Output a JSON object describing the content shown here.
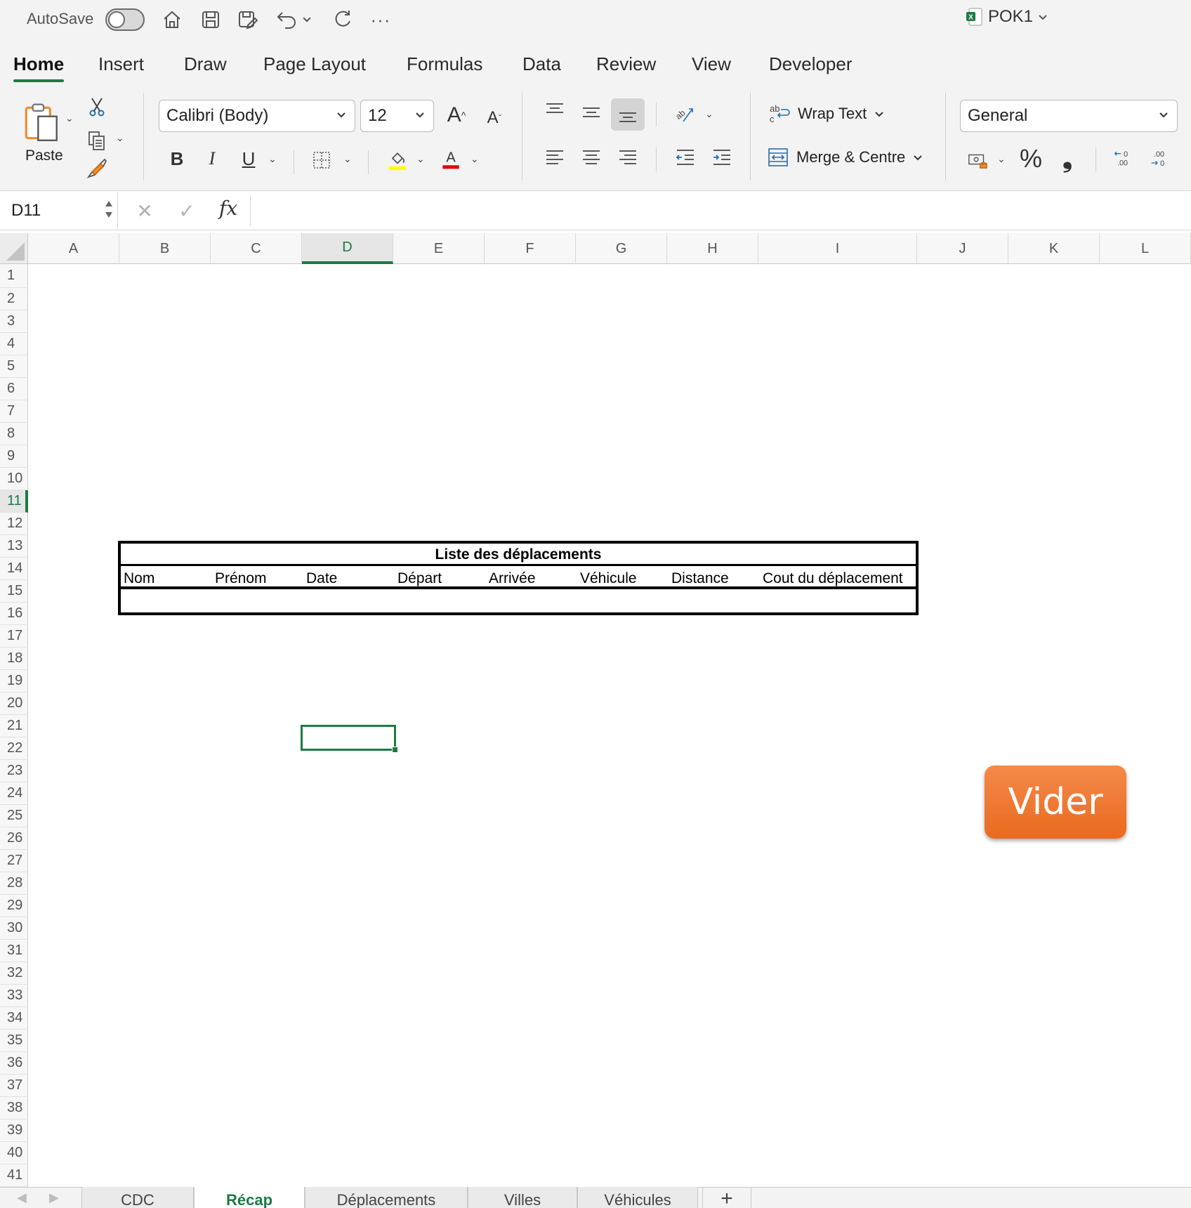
{
  "titlebar": {
    "autosave_label": "AutoSave",
    "more_label": "···",
    "file_name": "POK1"
  },
  "ribbon_tabs": [
    "Home",
    "Insert",
    "Draw",
    "Page Layout",
    "Formulas",
    "Data",
    "Review",
    "View",
    "Developer"
  ],
  "ribbon": {
    "paste_label": "Paste",
    "font_name": "Calibri (Body)",
    "font_size": "12",
    "bold": "B",
    "italic": "I",
    "underline": "U",
    "wrap_text": "Wrap Text",
    "merge_centre": "Merge & Centre",
    "number_format": "General",
    "percent": "%",
    "comma": "❟",
    "highlight_color": "#ffff00",
    "font_color": "#e00000"
  },
  "formula_bar": {
    "name_box": "D11",
    "fx_label": "fx",
    "value": ""
  },
  "grid": {
    "columns": [
      "A",
      "B",
      "C",
      "D",
      "E",
      "F",
      "G",
      "H",
      "I",
      "J",
      "K",
      "L"
    ],
    "selected_column": "D",
    "row_count": 41,
    "selected_row": 11,
    "active_cell": "D11"
  },
  "table": {
    "title": "Liste des déplacements",
    "headers": [
      "Nom",
      "Prénom",
      "Date",
      "Départ",
      "Arrivée",
      "Véhicule",
      "Distance",
      "Cout du déplacement"
    ]
  },
  "vider_button": {
    "label": "Vider",
    "color": "#ee7530"
  },
  "sheet_tabs": {
    "tabs": [
      "CDC",
      "Récap",
      "Déplacements",
      "Villes",
      "Véhicules"
    ],
    "active": "Récap",
    "add_label": "+"
  },
  "colors": {
    "accent": "#1e7a45"
  }
}
